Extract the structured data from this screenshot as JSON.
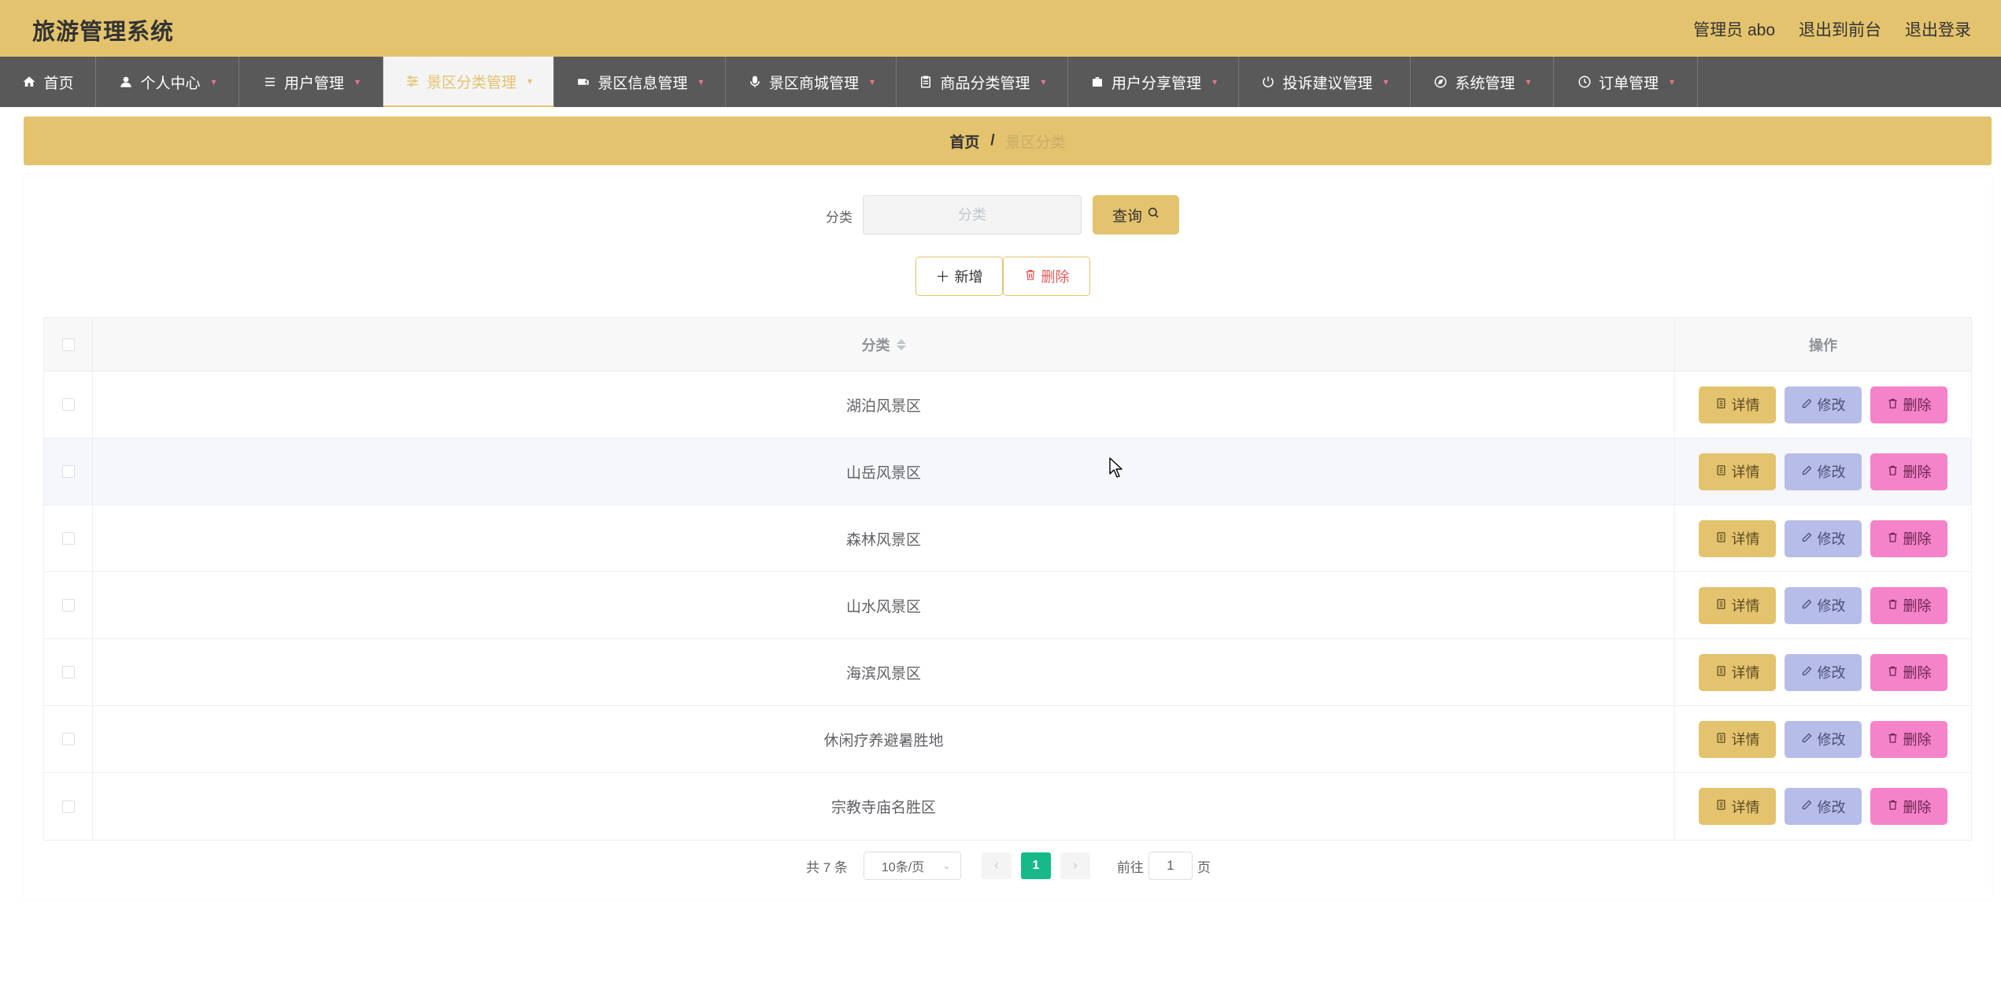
{
  "header": {
    "title": "旅游管理系统",
    "admin_label": "管理员 abo",
    "front_label": "退出到前台",
    "logout_label": "退出登录"
  },
  "nav": {
    "items": [
      {
        "label": "首页",
        "icon": "home-icon"
      },
      {
        "label": "个人中心",
        "icon": "user-icon"
      },
      {
        "label": "用户管理",
        "icon": "list-icon"
      },
      {
        "label": "景区分类管理",
        "icon": "sliders-icon"
      },
      {
        "label": "景区信息管理",
        "icon": "ticket-icon"
      },
      {
        "label": "景区商城管理",
        "icon": "microphone-icon"
      },
      {
        "label": "商品分类管理",
        "icon": "clipboard-icon"
      },
      {
        "label": "用户分享管理",
        "icon": "briefcase-icon"
      },
      {
        "label": "投诉建议管理",
        "icon": "power-icon"
      },
      {
        "label": "系统管理",
        "icon": "compass-icon"
      },
      {
        "label": "订单管理",
        "icon": "clock-icon"
      }
    ],
    "active_index": 3
  },
  "breadcrumb": {
    "home": "首页",
    "separator": "/",
    "current": "景区分类"
  },
  "search": {
    "label": "分类",
    "placeholder": "分类",
    "value": "",
    "button_label": "查询"
  },
  "actions": {
    "add_label": "新增",
    "delete_label": "删除"
  },
  "table": {
    "columns": [
      "分类",
      "操作"
    ],
    "rows": [
      {
        "category": "湖泊风景区"
      },
      {
        "category": "山岳风景区"
      },
      {
        "category": "森林风景区"
      },
      {
        "category": "山水风景区"
      },
      {
        "category": "海滨风景区"
      },
      {
        "category": "休闲疗养避暑胜地"
      },
      {
        "category": "宗教寺庙名胜区"
      }
    ],
    "ops": {
      "detail": "详情",
      "edit": "修改",
      "delete": "删除"
    }
  },
  "pagination": {
    "total": "共 7 条",
    "page_size": "10条/页",
    "current_page": "1",
    "goto_label": "前往",
    "goto_value": "1",
    "page_suffix": "页"
  },
  "colors": {
    "primary": "#e4c36e",
    "nav_bg": "#595959",
    "edit": "#b7bde9",
    "remove": "#f483c9",
    "page_active": "#18b989"
  }
}
